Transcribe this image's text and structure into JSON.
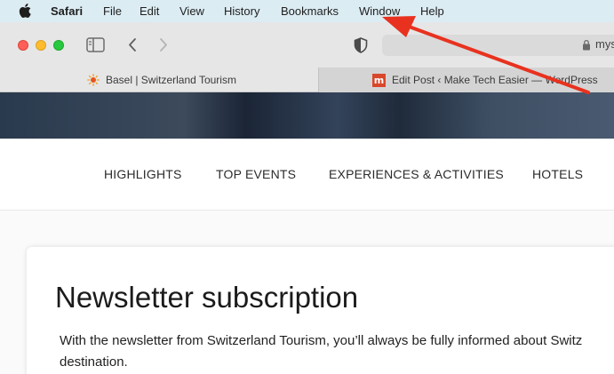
{
  "menubar": {
    "apple_icon": "apple-logo",
    "items": [
      "Safari",
      "File",
      "Edit",
      "View",
      "History",
      "Bookmarks",
      "Window",
      "Help"
    ]
  },
  "toolbar": {
    "address_text": "mys",
    "icons": [
      "sidebar-icon",
      "back-icon",
      "forward-icon",
      "privacy-shield-icon",
      "lock-icon"
    ]
  },
  "tabs": [
    {
      "label": "Basel | Switzerland Tourism",
      "favicon": "sun-icon"
    },
    {
      "label": "Edit Post ‹ Make Tech Easier — WordPress",
      "favicon": "m"
    }
  ],
  "nav": {
    "items": [
      "HIGHLIGHTS",
      "TOP EVENTS",
      "EXPERIENCES & ACTIVITIES",
      "HOTELS"
    ]
  },
  "card": {
    "title": "Newsletter subscription",
    "text": "With the newsletter from Switzerland Tourism, you’ll always be fully informed about Switz destination."
  },
  "colors": {
    "menubar": "#dcecf3",
    "annotation_arrow": "#e8321f",
    "close": "#fe5f57",
    "minimize": "#febc2e",
    "zoom": "#28c840"
  }
}
